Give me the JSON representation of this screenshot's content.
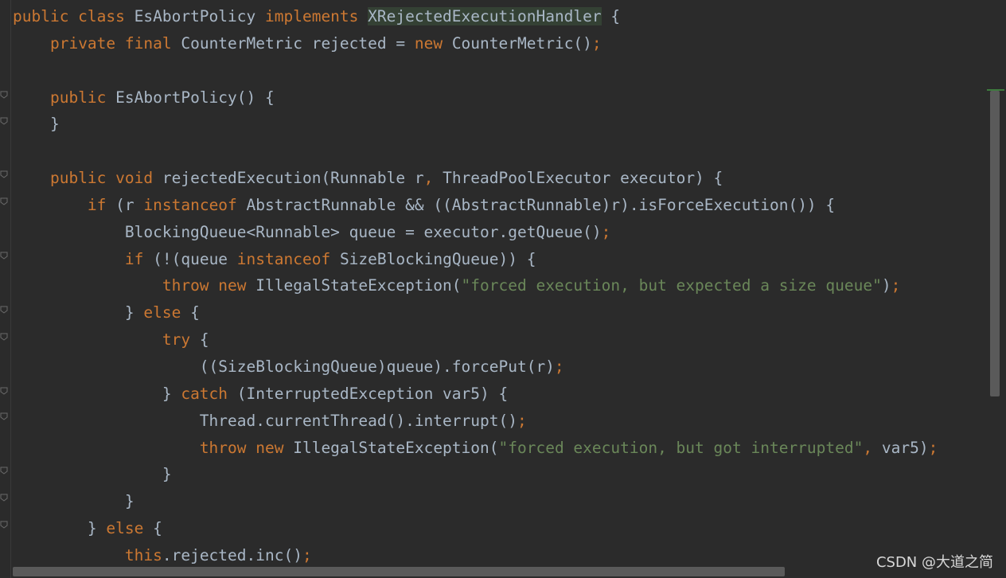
{
  "editor": {
    "lines": [
      [
        [
          "kw",
          "public class "
        ],
        [
          "id",
          "EsAbortPolicy "
        ],
        [
          "kw",
          "implements "
        ],
        [
          "hl",
          "XRejectedExecutionHandler"
        ],
        [
          "id",
          " {"
        ]
      ],
      [
        [
          "id",
          "    "
        ],
        [
          "kw",
          "private final "
        ],
        [
          "id",
          "CounterMetric rejected = "
        ],
        [
          "kw",
          "new "
        ],
        [
          "id",
          "CounterMetric()"
        ],
        [
          "punc",
          ";"
        ]
      ],
      [
        [
          "id",
          ""
        ]
      ],
      [
        [
          "id",
          "    "
        ],
        [
          "kw",
          "public "
        ],
        [
          "id",
          "EsAbortPolicy() {"
        ]
      ],
      [
        [
          "id",
          "    }"
        ]
      ],
      [
        [
          "id",
          ""
        ]
      ],
      [
        [
          "id",
          "    "
        ],
        [
          "kw",
          "public void "
        ],
        [
          "id",
          "rejectedExecution(Runnable r"
        ],
        [
          "punc",
          ", "
        ],
        [
          "id",
          "ThreadPoolExecutor executor) {"
        ]
      ],
      [
        [
          "id",
          "        "
        ],
        [
          "kw",
          "if "
        ],
        [
          "id",
          "(r "
        ],
        [
          "kw",
          "instanceof "
        ],
        [
          "id",
          "AbstractRunnable && ((AbstractRunnable)r).isForceExecution()) {"
        ]
      ],
      [
        [
          "id",
          "            BlockingQueue<Runnable> queue = executor.getQueue()"
        ],
        [
          "punc",
          ";"
        ]
      ],
      [
        [
          "id",
          "            "
        ],
        [
          "kw",
          "if "
        ],
        [
          "id",
          "(!(queue "
        ],
        [
          "kw",
          "instanceof "
        ],
        [
          "id",
          "SizeBlockingQueue)) {"
        ]
      ],
      [
        [
          "id",
          "                "
        ],
        [
          "kw",
          "throw new "
        ],
        [
          "id",
          "IllegalStateException("
        ],
        [
          "str",
          "\"forced execution, but expected a size queue\""
        ],
        [
          "id",
          ")"
        ],
        [
          "punc",
          ";"
        ]
      ],
      [
        [
          "id",
          "            } "
        ],
        [
          "kw",
          "else "
        ],
        [
          "id",
          "{"
        ]
      ],
      [
        [
          "id",
          "                "
        ],
        [
          "kw",
          "try "
        ],
        [
          "id",
          "{"
        ]
      ],
      [
        [
          "id",
          "                    ((SizeBlockingQueue)queue).forcePut(r)"
        ],
        [
          "punc",
          ";"
        ]
      ],
      [
        [
          "id",
          "                } "
        ],
        [
          "kw",
          "catch "
        ],
        [
          "id",
          "(InterruptedException var5) {"
        ]
      ],
      [
        [
          "id",
          "                    Thread.currentThread().interrupt()"
        ],
        [
          "punc",
          ";"
        ]
      ],
      [
        [
          "id",
          "                    "
        ],
        [
          "kw",
          "throw new "
        ],
        [
          "id",
          "IllegalStateException("
        ],
        [
          "str",
          "\"forced execution, but got interrupted\""
        ],
        [
          "punc",
          ", "
        ],
        [
          "id",
          "var5)"
        ],
        [
          "punc",
          ";"
        ]
      ],
      [
        [
          "id",
          "                }"
        ]
      ],
      [
        [
          "id",
          "            }"
        ]
      ],
      [
        [
          "id",
          "        } "
        ],
        [
          "kw",
          "else "
        ],
        [
          "id",
          "{"
        ]
      ],
      [
        [
          "id",
          "            "
        ],
        [
          "kw",
          "this"
        ],
        [
          "id",
          ".rejected.inc()"
        ],
        [
          "punc",
          ";"
        ]
      ]
    ]
  },
  "watermark": "CSDN @大道之简",
  "colors": {
    "background": "#2b2b2b",
    "keyword": "#cc7832",
    "identifier": "#a9b7c6",
    "string": "#6a8759",
    "highlight_bg": "#344134",
    "scrollbar": "#5a5a5a"
  },
  "icons": [
    "fold-marker-icon"
  ]
}
